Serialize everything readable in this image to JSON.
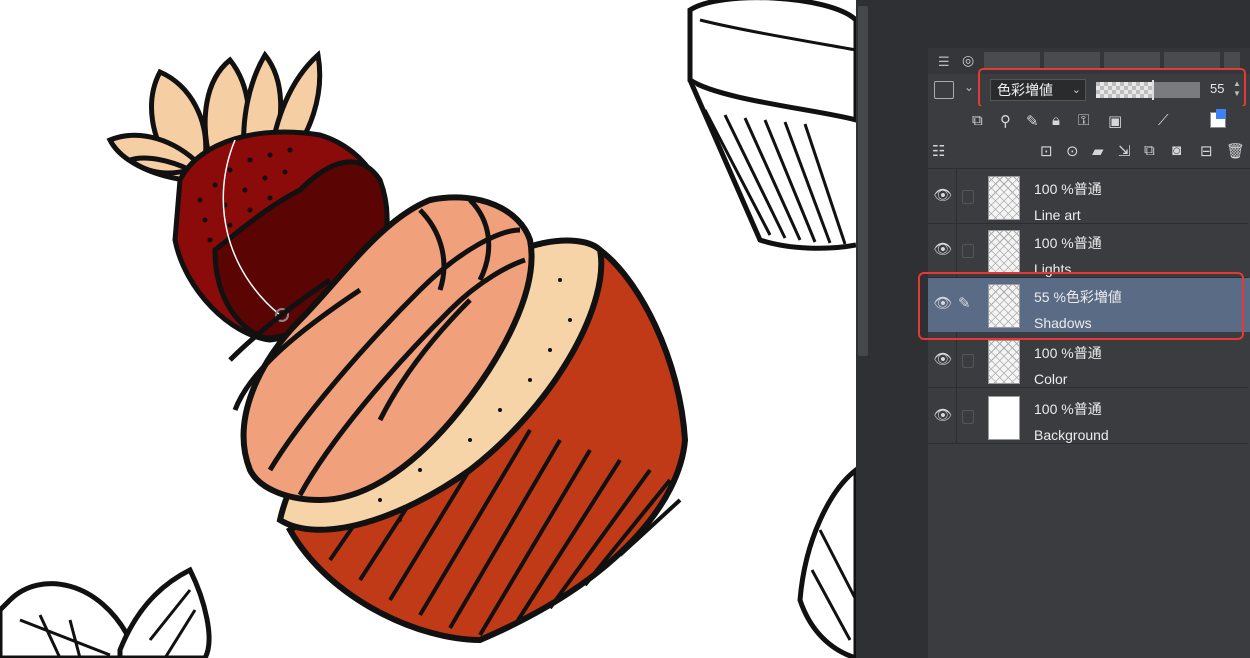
{
  "blend_bar": {
    "mode": "色彩増値",
    "opacity": "55",
    "opacity_fraction": 0.55
  },
  "layers": [
    {
      "opacity_mode": "100 %普通",
      "name": "Line art",
      "thumb": "checker",
      "selected": false
    },
    {
      "opacity_mode": "100 %普通",
      "name": "Lights",
      "thumb": "checker",
      "selected": false
    },
    {
      "opacity_mode": "55 %色彩増値",
      "name": "Shadows",
      "thumb": "checker",
      "selected": true
    },
    {
      "opacity_mode": "100 %普通",
      "name": "Color",
      "thumb": "checker",
      "selected": false
    },
    {
      "opacity_mode": "100 %普通",
      "name": "Background",
      "thumb": "white",
      "selected": false
    }
  ],
  "icons": {
    "panel_menu": "menu-icon",
    "layer_tab": "layers-icon",
    "visibility": "eye-icon",
    "editing": "pen-icon",
    "delete": "trash-icon"
  },
  "colors": {
    "highlight": "#e53935",
    "selected_layer": "#5a6b85",
    "panel": "#3b3c3f",
    "cup": "#c03a17",
    "frosting": "#f0a07a",
    "cake": "#f7d3a8",
    "strawberry": "#8b0a0a",
    "chocolate": "#5a0404",
    "leaves": "#f5cfa3"
  }
}
